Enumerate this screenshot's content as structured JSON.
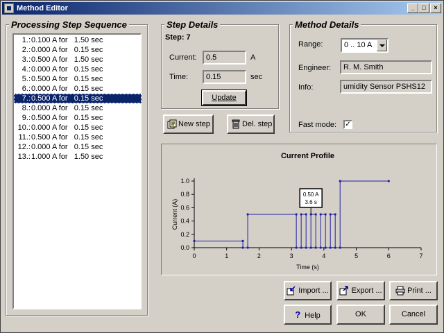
{
  "window": {
    "title": "Method Editor",
    "controls": [
      "_",
      "□",
      "×"
    ]
  },
  "sequence": {
    "title": "Processing Step Sequence",
    "items": [
      {
        "num": "1.:",
        "text": "0.100 A for   1.50 sec"
      },
      {
        "num": "2.:",
        "text": "0.000 A for   0.15 sec"
      },
      {
        "num": "3.:",
        "text": "0.500 A for   1.50 sec"
      },
      {
        "num": "4.:",
        "text": "0.000 A for   0.15 sec"
      },
      {
        "num": "5.:",
        "text": "0.500 A for   0.15 sec"
      },
      {
        "num": "6.:",
        "text": "0.000 A for   0.15 sec"
      },
      {
        "num": "7.:",
        "text": "0.500 A for   0.15 sec"
      },
      {
        "num": "8.:",
        "text": "0.000 A for   0.15 sec"
      },
      {
        "num": "9.:",
        "text": "0.500 A for   0.15 sec"
      },
      {
        "num": "10.:",
        "text": "0.000 A for   0.15 sec"
      },
      {
        "num": "11.:",
        "text": "0.500 A for   0.15 sec"
      },
      {
        "num": "12.:",
        "text": "0.000 A for   0.15 sec"
      },
      {
        "num": "13.:",
        "text": "1.000 A for   1.50 sec"
      }
    ],
    "selected_index": 6
  },
  "step_details": {
    "title": "Step Details",
    "step_label": "Step: 7",
    "current_label": "Current:",
    "current_value": "0.5",
    "current_unit": "A",
    "time_label": "Time:",
    "time_value": "0.15",
    "time_unit": "sec",
    "update_button": "Update"
  },
  "step_buttons": {
    "new_step": "New step",
    "del_step": "Del. step"
  },
  "method_details": {
    "title": "Method Details",
    "range_label": "Range:",
    "range_value": "0 .. 10 A",
    "engineer_label": "Engineer:",
    "engineer_value": "R. M. Smith",
    "info_label": "Info:",
    "info_value": "umidity Sensor PSHS12",
    "fast_mode_label": "Fast mode:",
    "fast_mode_checked": "✓"
  },
  "chart_data": {
    "type": "line",
    "title": "Current Profile",
    "xlabel": "Time (s)",
    "ylabel": "Current (A)",
    "xlim": [
      0,
      7
    ],
    "ylim": [
      0,
      1.0
    ],
    "x_ticks": [
      "0",
      "1",
      "2",
      "3",
      "4",
      "5",
      "6",
      "7"
    ],
    "y_ticks": [
      "0.0",
      "0.2",
      "0.4",
      "0.6",
      "0.8",
      "1.0"
    ],
    "series": [
      {
        "steps": [
          {
            "current": 0.1,
            "duration": 1.5
          },
          {
            "current": 0.0,
            "duration": 0.15
          },
          {
            "current": 0.5,
            "duration": 1.5
          },
          {
            "current": 0.0,
            "duration": 0.15
          },
          {
            "current": 0.5,
            "duration": 0.15
          },
          {
            "current": 0.0,
            "duration": 0.15
          },
          {
            "current": 0.5,
            "duration": 0.15
          },
          {
            "current": 0.0,
            "duration": 0.15
          },
          {
            "current": 0.5,
            "duration": 0.15
          },
          {
            "current": 0.0,
            "duration": 0.15
          },
          {
            "current": 0.5,
            "duration": 0.15
          },
          {
            "current": 0.0,
            "duration": 0.15
          },
          {
            "current": 1.0,
            "duration": 1.5
          }
        ]
      }
    ],
    "annotation": {
      "line1": "0.50 A",
      "line2": "3.6 s",
      "x": 3.6,
      "y": 0.5
    },
    "line_color": "#2020a0"
  },
  "bottom_buttons": {
    "import": "Import ...",
    "export": "Export ...",
    "print": "Print ...",
    "help": "Help",
    "ok": "OK",
    "cancel": "Cancel"
  }
}
